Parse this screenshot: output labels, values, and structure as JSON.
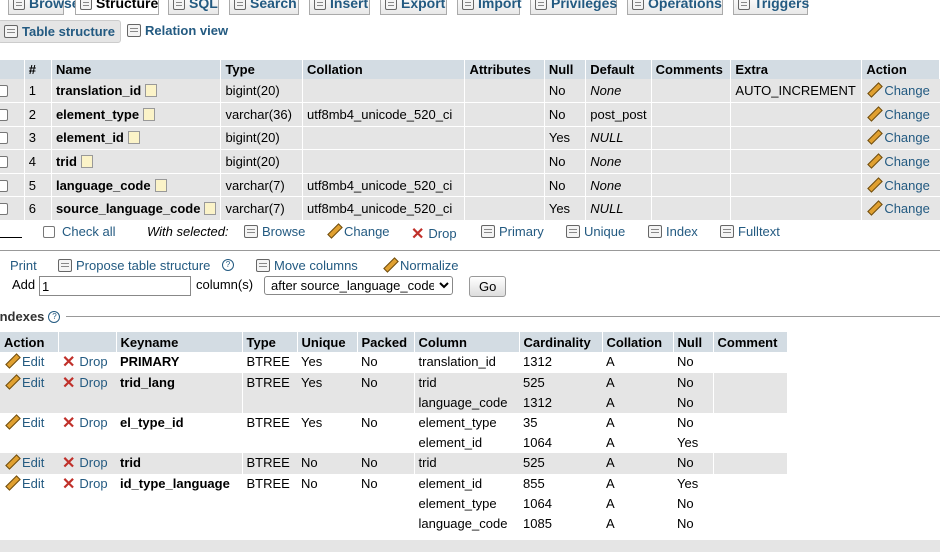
{
  "tabs": [
    {
      "label": "Browse",
      "icon": "browse-icon"
    },
    {
      "label": "Structure",
      "icon": "structure-icon",
      "active": true
    },
    {
      "label": "SQL",
      "icon": "sql-icon"
    },
    {
      "label": "Search",
      "icon": "search-icon"
    },
    {
      "label": "Insert",
      "icon": "insert-icon"
    },
    {
      "label": "Export",
      "icon": "export-icon"
    },
    {
      "label": "Import",
      "icon": "import-icon"
    },
    {
      "label": "Privileges",
      "icon": "privileges-icon"
    },
    {
      "label": "Operations",
      "icon": "operations-icon"
    },
    {
      "label": "Triggers",
      "icon": "triggers-icon"
    }
  ],
  "subtabs": [
    {
      "label": "Table structure",
      "active": true
    },
    {
      "label": "Relation view"
    }
  ],
  "structure": {
    "headers": [
      "#",
      "Name",
      "Type",
      "Collation",
      "Attributes",
      "Null",
      "Default",
      "Comments",
      "Extra",
      "Action"
    ],
    "change_label": "Change",
    "rows": [
      {
        "num": "1",
        "name": "translation_id",
        "type": "bigint(20)",
        "collation": "",
        "attributes": "",
        "null": "No",
        "default": "None",
        "default_italic": true,
        "comments": "",
        "extra": "AUTO_INCREMENT"
      },
      {
        "num": "2",
        "name": "element_type",
        "type": "varchar(36)",
        "collation": "utf8mb4_unicode_520_ci",
        "attributes": "",
        "null": "No",
        "default": "post_post",
        "default_italic": false,
        "comments": "",
        "extra": ""
      },
      {
        "num": "3",
        "name": "element_id",
        "type": "bigint(20)",
        "collation": "",
        "attributes": "",
        "null": "Yes",
        "default": "NULL",
        "default_italic": true,
        "comments": "",
        "extra": ""
      },
      {
        "num": "4",
        "name": "trid",
        "type": "bigint(20)",
        "collation": "",
        "attributes": "",
        "null": "No",
        "default": "None",
        "default_italic": true,
        "comments": "",
        "extra": ""
      },
      {
        "num": "5",
        "name": "language_code",
        "type": "varchar(7)",
        "collation": "utf8mb4_unicode_520_ci",
        "attributes": "",
        "null": "No",
        "default": "None",
        "default_italic": true,
        "comments": "",
        "extra": ""
      },
      {
        "num": "6",
        "name": "source_language_code",
        "type": "varchar(7)",
        "collation": "utf8mb4_unicode_520_ci",
        "attributes": "",
        "null": "Yes",
        "default": "NULL",
        "default_italic": true,
        "comments": "",
        "extra": ""
      }
    ]
  },
  "bulk": {
    "check_all": "Check all",
    "with_selected": "With selected:",
    "actions": [
      {
        "label": "Browse",
        "icon": "browse-icon"
      },
      {
        "label": "Change",
        "icon": "pencil-icon"
      },
      {
        "label": "Drop",
        "icon": "drop-icon"
      },
      {
        "label": "Primary",
        "icon": "primary-key-icon"
      },
      {
        "label": "Unique",
        "icon": "unique-icon"
      },
      {
        "label": "Index",
        "icon": "index-icon"
      },
      {
        "label": "Fulltext",
        "icon": "fulltext-icon"
      }
    ]
  },
  "tools": {
    "print": "Print",
    "propose": "Propose table structure",
    "move": "Move columns",
    "normalize": "Normalize"
  },
  "add_column": {
    "add_label": "Add",
    "count": "1",
    "columns_label": "column(s)",
    "position": "after source_language_code",
    "go": "Go"
  },
  "indexes": {
    "title": "Indexes",
    "headers": [
      "Action",
      "",
      "Keyname",
      "Type",
      "Unique",
      "Packed",
      "Column",
      "Cardinality",
      "Collation",
      "Null",
      "Comment"
    ],
    "edit_label": "Edit",
    "drop_label": "Drop",
    "items": [
      {
        "keyname": "PRIMARY",
        "type": "BTREE",
        "unique": "Yes",
        "packed": "No",
        "columns": [
          {
            "column": "translation_id",
            "cardinality": "1312",
            "collation": "A",
            "null": "No"
          }
        ]
      },
      {
        "keyname": "trid_lang",
        "type": "BTREE",
        "unique": "Yes",
        "packed": "No",
        "columns": [
          {
            "column": "trid",
            "cardinality": "525",
            "collation": "A",
            "null": "No"
          },
          {
            "column": "language_code",
            "cardinality": "1312",
            "collation": "A",
            "null": "No"
          }
        ]
      },
      {
        "keyname": "el_type_id",
        "type": "BTREE",
        "unique": "Yes",
        "packed": "No",
        "columns": [
          {
            "column": "element_type",
            "cardinality": "35",
            "collation": "A",
            "null": "No"
          },
          {
            "column": "element_id",
            "cardinality": "1064",
            "collation": "A",
            "null": "Yes"
          }
        ]
      },
      {
        "keyname": "trid",
        "type": "BTREE",
        "unique": "No",
        "packed": "No",
        "columns": [
          {
            "column": "trid",
            "cardinality": "525",
            "collation": "A",
            "null": "No"
          }
        ]
      },
      {
        "keyname": "id_type_language",
        "type": "BTREE",
        "unique": "No",
        "packed": "No",
        "columns": [
          {
            "column": "element_id",
            "cardinality": "855",
            "collation": "A",
            "null": "Yes"
          },
          {
            "column": "element_type",
            "cardinality": "1064",
            "collation": "A",
            "null": "No"
          },
          {
            "column": "language_code",
            "cardinality": "1085",
            "collation": "A",
            "null": "No"
          }
        ]
      }
    ]
  }
}
